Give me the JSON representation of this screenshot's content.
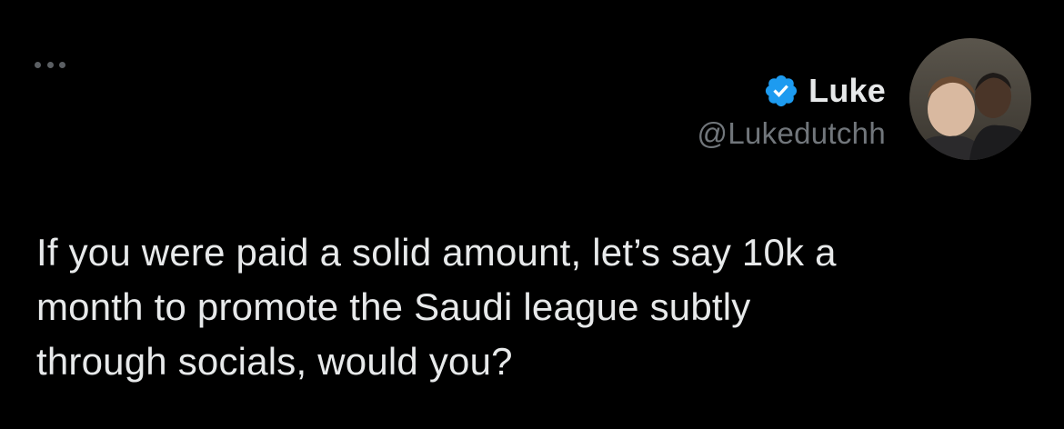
{
  "tweet": {
    "author": {
      "display_name": "Luke",
      "handle": "@Lukedutchh",
      "verified": true,
      "avatar_icon": "profile-photo"
    },
    "more_icon": "ellipsis-icon",
    "text": "If you were paid a solid amount, let’s say 10k a\nmonth to promote the Saudi league subtly\nthrough socials, would you?"
  },
  "colors": {
    "background": "#000000",
    "text_primary": "#e7e9ea",
    "text_secondary": "#71767b",
    "verified_blue": "#1d9bf0"
  }
}
